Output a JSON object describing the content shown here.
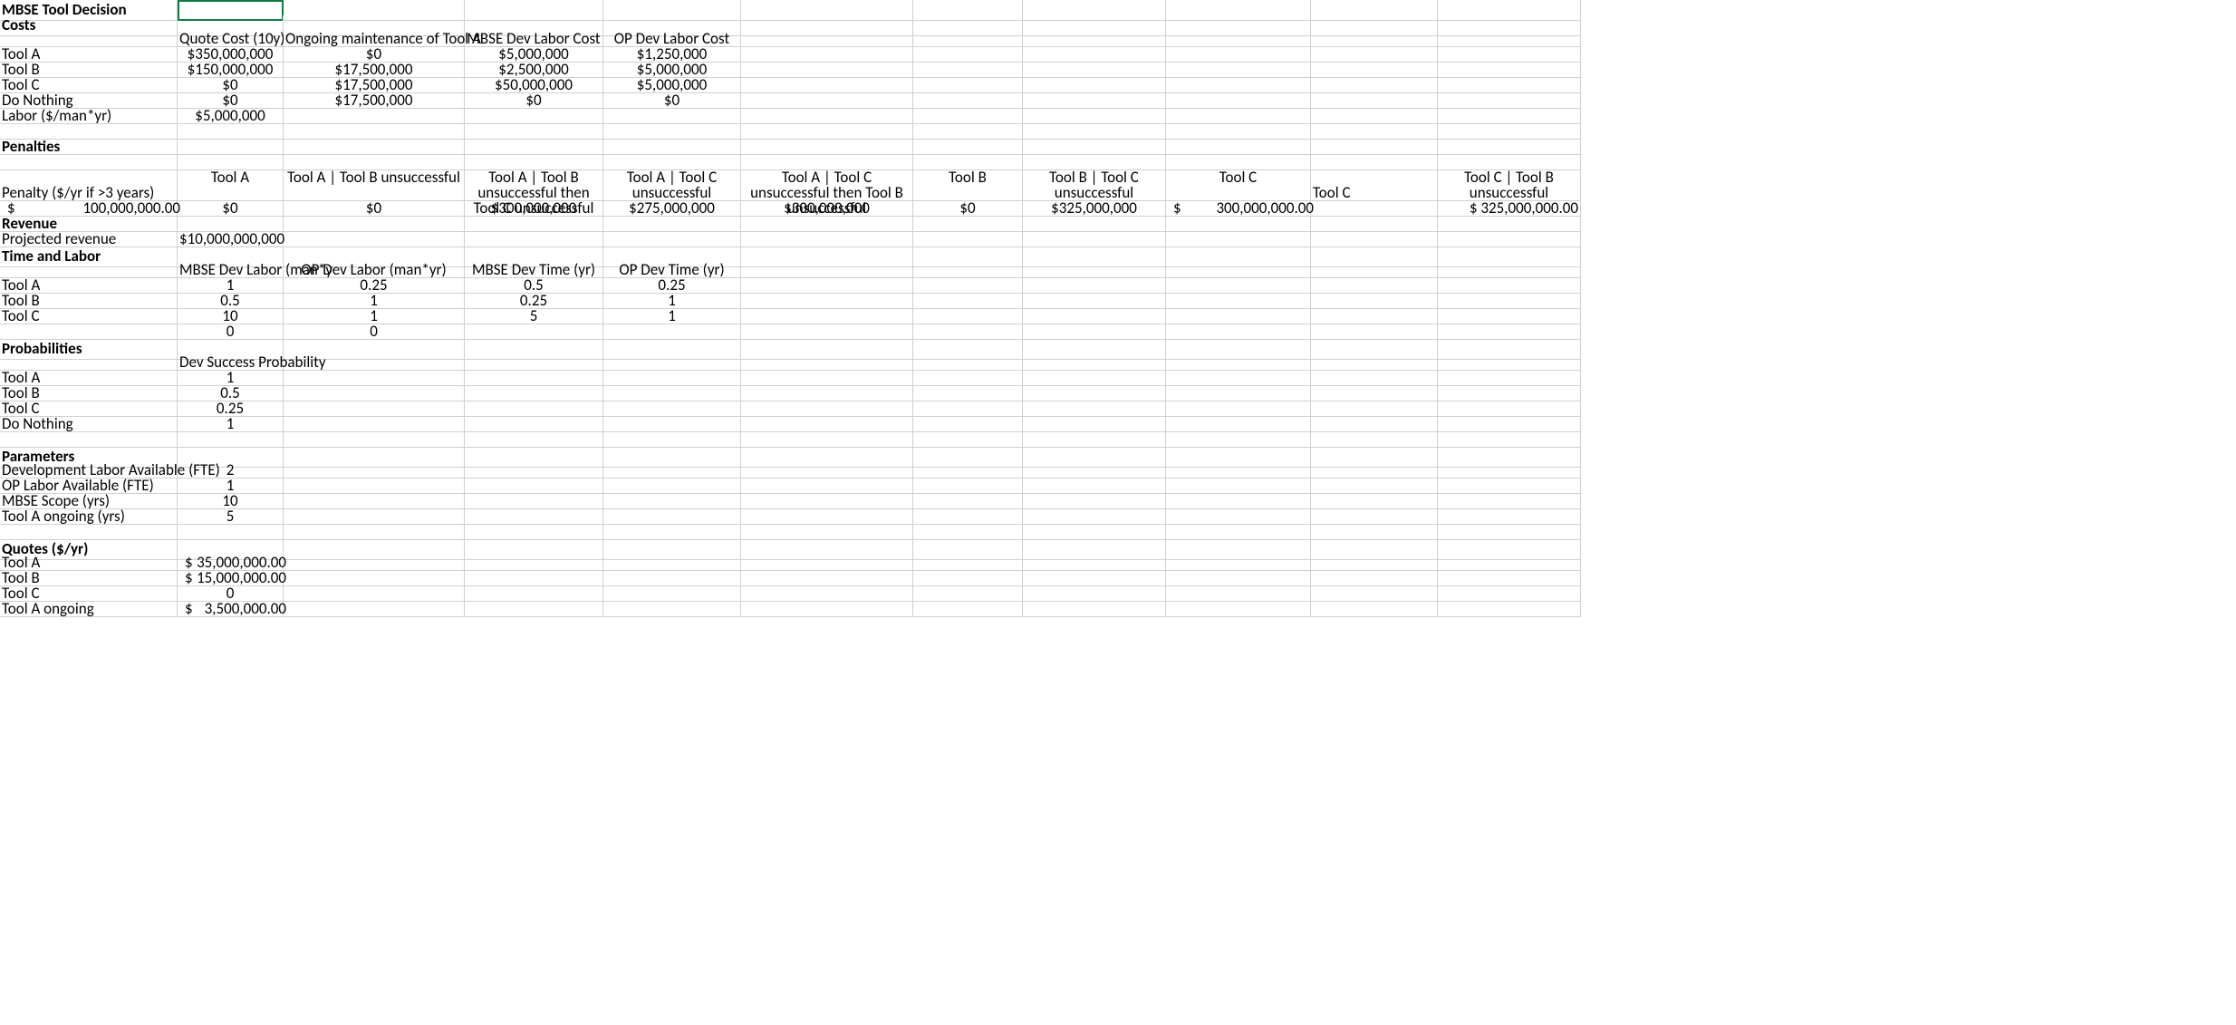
{
  "title": "MBSE Tool Decision",
  "sections": {
    "costs": {
      "header": "Costs",
      "cols": [
        "Quote Cost (10y)",
        "Ongoing maintenance of Tool A",
        "MBSE Dev Labor Cost",
        "OP Dev Labor Cost"
      ],
      "rows": [
        {
          "label": "Tool A",
          "v": [
            "$350,000,000",
            "$0",
            "$5,000,000",
            "$1,250,000"
          ]
        },
        {
          "label": "Tool B",
          "v": [
            "$150,000,000",
            "$17,500,000",
            "$2,500,000",
            "$5,000,000"
          ]
        },
        {
          "label": "Tool C",
          "v": [
            "$0",
            "$17,500,000",
            "$50,000,000",
            "$5,000,000"
          ]
        },
        {
          "label": "Do Nothing",
          "v": [
            "$0",
            "$17,500,000",
            "$0",
            "$0"
          ]
        },
        {
          "label": "Labor ($/man*yr)",
          "v": [
            "$5,000,000",
            "",
            "",
            ""
          ]
        }
      ]
    },
    "penalties": {
      "header": "Penalties",
      "labelRow": {
        "a": "Penalty ($/yr if >3 years)",
        "cols": [
          "Tool A",
          "Tool A | Tool B unsuccessful",
          "Tool A | Tool B unsuccessful then Tool C unsuccessful",
          "Tool A | Tool C unsuccessful",
          "Tool A | Tool C unsuccessful then Tool B unsuccessful",
          "Tool B",
          "Tool B | Tool C unsuccessful",
          "Tool C",
          "Tool C | Tool B unsuccessful"
        ]
      },
      "valueRow": {
        "a_symbol": "$",
        "a_value": "100,000,000.00",
        "v": [
          "$0",
          "$0",
          "$300,000,000",
          "$275,000,000",
          "$300,000,000",
          "$0",
          "$325,000,000"
        ],
        "v8_symbol": "$",
        "v8_value": "300,000,000.00",
        "v9": "$ 325,000,000.00"
      }
    },
    "revenue": {
      "header": "Revenue",
      "row": {
        "label": "Projected revenue",
        "v": "$10,000,000,000"
      }
    },
    "time": {
      "header": "Time and Labor",
      "cols": [
        "MBSE Dev Labor (man*y",
        "OP Dev Labor (man*yr)",
        "MBSE Dev Time (yr)",
        "OP Dev Time (yr)"
      ],
      "rows": [
        {
          "label": "Tool A",
          "v": [
            "1",
            "0.25",
            "0.5",
            "0.25"
          ]
        },
        {
          "label": "Tool B",
          "v": [
            "0.5",
            "1",
            "0.25",
            "1"
          ]
        },
        {
          "label": "Tool C",
          "v": [
            "10",
            "1",
            "5",
            "1"
          ]
        },
        {
          "label": "",
          "v": [
            "0",
            "0",
            "",
            ""
          ]
        }
      ]
    },
    "probabilities": {
      "header": "Probabilities",
      "col": "Dev Success Probability",
      "rows": [
        {
          "label": "Tool A",
          "v": "1"
        },
        {
          "label": "Tool B",
          "v": "0.5"
        },
        {
          "label": "Tool C",
          "v": "0.25"
        },
        {
          "label": "Do Nothing",
          "v": "1"
        }
      ]
    },
    "parameters": {
      "header": "Parameters",
      "rows": [
        {
          "label": "Development Labor Available (FTE)",
          "v": "2"
        },
        {
          "label": "OP Labor Available (FTE)",
          "v": "1"
        },
        {
          "label": "MBSE Scope (yrs)",
          "v": "10"
        },
        {
          "label": "Tool A ongoing (yrs)",
          "v": "5"
        }
      ]
    },
    "quotes": {
      "header": "Quotes ($/yr)",
      "rows": [
        {
          "label": "Tool A",
          "sym": "$",
          "v": "35,000,000.00"
        },
        {
          "label": "Tool B",
          "sym": "$",
          "v": "15,000,000.00"
        },
        {
          "label": "Tool C",
          "sym": "",
          "v": "0"
        },
        {
          "label": "Tool A ongoing",
          "sym": "$",
          "v": "3,500,000.00"
        }
      ]
    }
  }
}
